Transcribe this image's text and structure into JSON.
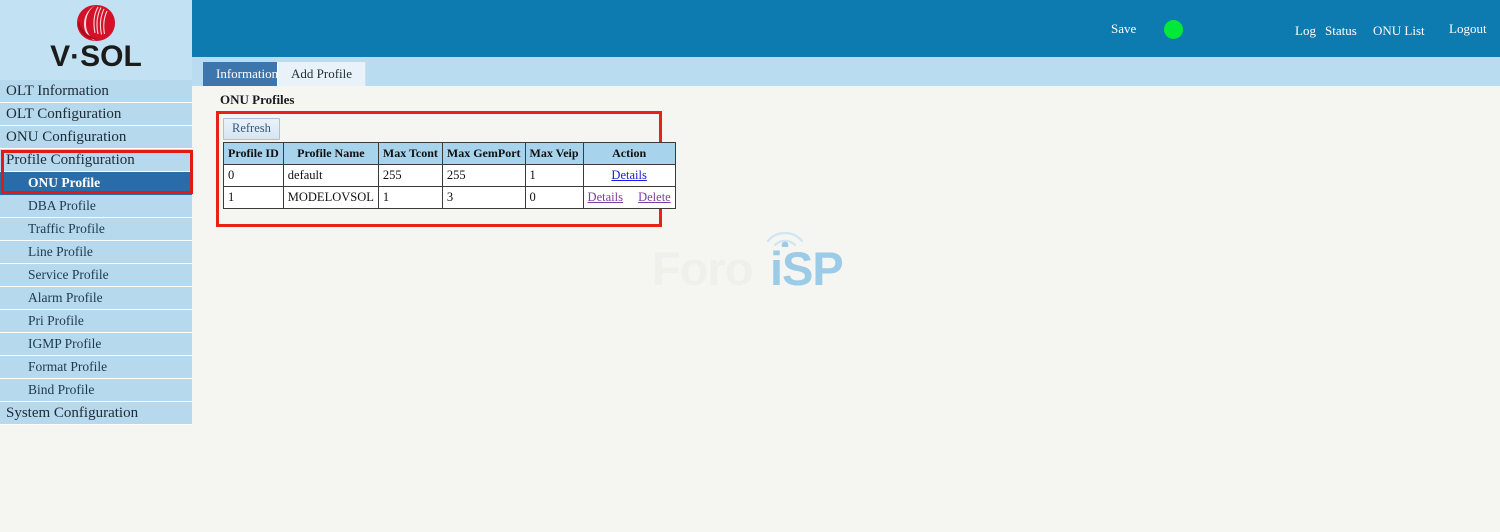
{
  "brand": {
    "name": "V·SOL",
    "logo_icon": "vsol-sphere-logo"
  },
  "header": {
    "save_label": "Save",
    "status_led_color": "#00e83a",
    "log_label": "Log",
    "status_label": "Status",
    "onu_list_label": "ONU List",
    "logout_label": "Logout",
    "background_color": "#0d7ab0"
  },
  "sidebar": {
    "background_color": "#b6d9ed",
    "active_color": "#2a6ca8",
    "items": [
      {
        "label": "OLT Information",
        "level": "top",
        "active": false
      },
      {
        "label": "OLT Configuration",
        "level": "top",
        "active": false
      },
      {
        "label": "ONU Configuration",
        "level": "top",
        "active": false
      },
      {
        "label": "Profile Configuration",
        "level": "top",
        "active": false
      },
      {
        "label": "ONU Profile",
        "level": "sub",
        "active": true
      },
      {
        "label": "DBA Profile",
        "level": "sub",
        "active": false
      },
      {
        "label": "Traffic Profile",
        "level": "sub",
        "active": false
      },
      {
        "label": "Line Profile",
        "level": "sub",
        "active": false
      },
      {
        "label": "Service Profile",
        "level": "sub",
        "active": false
      },
      {
        "label": "Alarm Profile",
        "level": "sub",
        "active": false
      },
      {
        "label": "Pri Profile",
        "level": "sub",
        "active": false
      },
      {
        "label": "IGMP Profile",
        "level": "sub",
        "active": false
      },
      {
        "label": "Format Profile",
        "level": "sub",
        "active": false
      },
      {
        "label": "Bind Profile",
        "level": "sub",
        "active": false
      },
      {
        "label": "System Configuration",
        "level": "top",
        "active": false
      }
    ]
  },
  "tabs": [
    {
      "label": "Information",
      "active": true
    },
    {
      "label": "Add Profile",
      "active": false
    }
  ],
  "main": {
    "page_title": "ONU Profiles",
    "refresh_label": "Refresh",
    "table": {
      "columns": [
        "Profile ID",
        "Profile Name",
        "Max Tcont",
        "Max GemPort",
        "Max Veip",
        "Action"
      ],
      "rows": [
        {
          "profile_id": "0",
          "profile_name": "default",
          "max_tcont": "255",
          "max_gemport": "255",
          "max_veip": "1",
          "actions": [
            {
              "label": "Details",
              "visited": false
            }
          ]
        },
        {
          "profile_id": "1",
          "profile_name": "MODELOVSOL",
          "max_tcont": "1",
          "max_gemport": "3",
          "max_veip": "0",
          "actions": [
            {
              "label": "Details",
              "visited": true
            },
            {
              "label": "Delete",
              "visited": true
            }
          ]
        }
      ]
    }
  },
  "annotations": {
    "color": "#e8211b",
    "sidebar_highlight": "Profile Configuration / ONU Profile",
    "panel_highlight": "ONU Profiles table"
  },
  "watermark": {
    "text_part1": "Foro",
    "text_part2": "iSP",
    "icon": "wifi-signal-icon",
    "color_part1": "#f0f0ea",
    "color_part2": "#9ccbe8"
  }
}
